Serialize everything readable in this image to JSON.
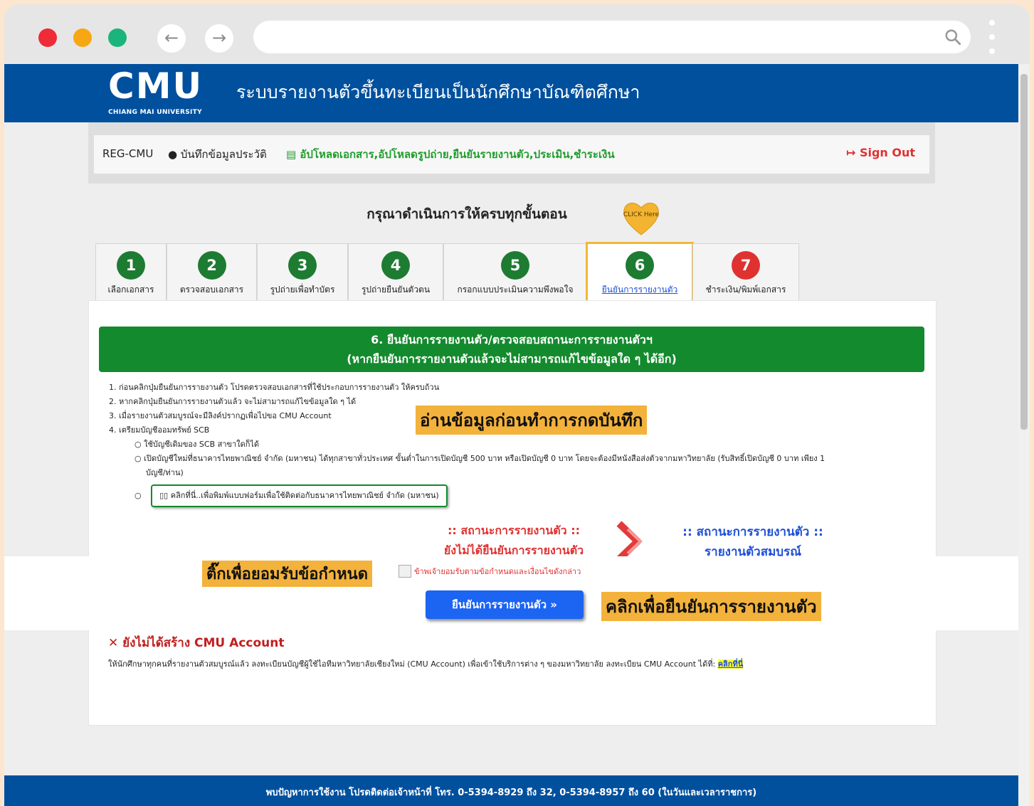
{
  "site": {
    "logo": "CMU",
    "logo_sub": "CHIANG MAI UNIVERSITY",
    "title": "ระบบรายงานตัวขึ้นทะเบียนเป็นนักศึกษาบัณฑิตศึกษา"
  },
  "nav": {
    "brand": "REG-CMU",
    "profile": "บันทึกข้อมูลประวัติ",
    "upload": "อัปโหลดเอกสาร,อัปโหลดรูปถ่าย,ยืนยันรายงานตัว,ประเมิน,ชำระเงิน",
    "signout": "Sign Out"
  },
  "steps_title": "กรุณาดำเนินการให้ครบทุกขั้นตอน",
  "heart_label": "CLICK Here",
  "tabs": [
    {
      "num": "1",
      "label": "เลือกเอกสาร",
      "color": "#1e7b32"
    },
    {
      "num": "2",
      "label": "ตรวจสอบเอกสาร",
      "color": "#1e7b32"
    },
    {
      "num": "3",
      "label": "รูปถ่ายเพื่อทำบัตร",
      "color": "#1e7b32"
    },
    {
      "num": "4",
      "label": "รูปถ่ายยืนยันตัวตน",
      "color": "#1e7b32"
    },
    {
      "num": "5",
      "label": "กรอกแบบประเมินความพึงพอใจ",
      "color": "#1e7b32"
    },
    {
      "num": "6",
      "label": "ยืนยันการรายงานตัว",
      "color": "#1e7b32"
    },
    {
      "num": "7",
      "label": "ชำระเงิน/พิมพ์เอกสาร",
      "color": "#e03131"
    }
  ],
  "section": {
    "heading1": "6. ยืนยันการรายงานตัว/ตรวจสอบสถานะการรายงานตัวฯ",
    "heading2": "(หากยืนยันการรายงานตัวแล้วจะไม่สามารถแก้ไขข้อมูลใด ๆ ได้อีก)"
  },
  "instructions": {
    "i1": "1. ก่อนคลิกปุ่มยืนยันการรายงานตัว โปรดตรวจสอบเอกสารที่ใช้ประกอบการรายงานตัว ให้ครบถ้วน",
    "i2": "2. หากคลิกปุ่มยืนยันการรายงานตัวแล้ว จะไม่สามารถแก้ไขข้อมูลใด ๆ ได้",
    "i3": "3. เมื่อรายงานตัวสมบูรณ์จะมีลิงค์ปรากฏเพื่อไปขอ CMU Account",
    "i4": "4. เตรียมบัญชีออมทรัพย์ SCB",
    "s1": "○  ใช้บัญชีเดิมของ SCB สาขาใดก็ได้",
    "s2": "○  เปิดบัญชีใหม่ที่ธนาคารไทยพาณิชย์ จำกัด (มหาชน) ได้ทุกสาขาทั่วประเทศ ขั้นต่ำในการเปิดบัญชี 500 บาท หรือเปิดบัญชี 0 บาท โดยจะต้องมีหนังสือส่งตัวจากมหาวิทยาลัย (รับสิทธิ์เปิดบัญชี 0 บาท เพียง 1",
    "s2b": "บัญชี/ท่าน)",
    "s3_bullet": "○",
    "pdf_button": "▯▯ คลิกที่นี่..เพื่อพิมพ์แบบฟอร์มเพื่อใช้ติดต่อกับธนาคารไทยพาณิชย์ จำกัด (มหาชน)"
  },
  "notes": {
    "read": "อ่านข้อมูลก่อนทำการกดบันทึก",
    "tick": "ติ๊กเพื่อยอมรับข้อกำหนด",
    "click": "คลิกเพื่อยืนยันการรายงานตัว"
  },
  "status": {
    "before_title": ":: สถานะการรายงานตัว ::",
    "before_value": "ยังไม่ได้ยืนยันการรายงานตัว",
    "after_title": ":: สถานะการรายงานตัว ::",
    "after_value": "รายงานตัวสมบูรณ์"
  },
  "agree_text": "ข้าพเจ้ายอมรับตามข้อกำหนดและเงื่อนไขดังกล่าว",
  "confirm_button": "ยืนยันการรายงานตัว  »",
  "cmu_account": {
    "title": "✕ ยังไม่ได้สร้าง CMU Account",
    "text": "ให้นักศึกษาทุกคนที่รายงานตัวสมบูรณ์แล้ว ลงทะเบียนบัญชีผู้ใช้ไอทีมหาวิทยาลัยเชียงใหม่ (CMU Account) เพื่อเข้าใช้บริการต่าง ๆ ของมหาวิทยาลัย ลงทะเบียน CMU Account ได้ที่: ",
    "link": "คลิกที่นี่"
  },
  "footer": "พบปัญหาการใช้งาน โปรดติดต่อเจ้าหน้าที่ โทร. 0-5394-8929 ถึง 32, 0-5394-8957 ถึง 60 (ในวันและเวลาราชการ)"
}
